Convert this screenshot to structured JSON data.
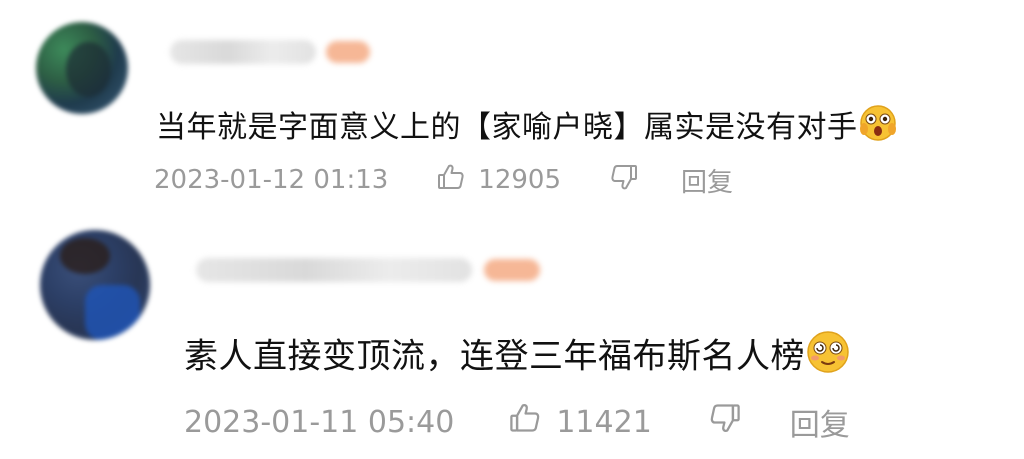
{
  "comments": [
    {
      "text": "当年就是字面意义上的【家喻户晓】属实是没有对手",
      "emoji": "shocked-face-emoji",
      "timestamp": "2023-01-12 01:13",
      "like_count": "12905",
      "reply_label": "回复"
    },
    {
      "text": "素人直接变顶流，连登三年福布斯名人榜",
      "emoji": "dizzy-face-emoji",
      "timestamp": "2023-01-11 05:40",
      "like_count": "11421",
      "reply_label": "回复"
    }
  ],
  "colors": {
    "text": "#111111",
    "meta": "#9a9a9a",
    "badge": "#f6b796",
    "background": "#ffffff"
  }
}
